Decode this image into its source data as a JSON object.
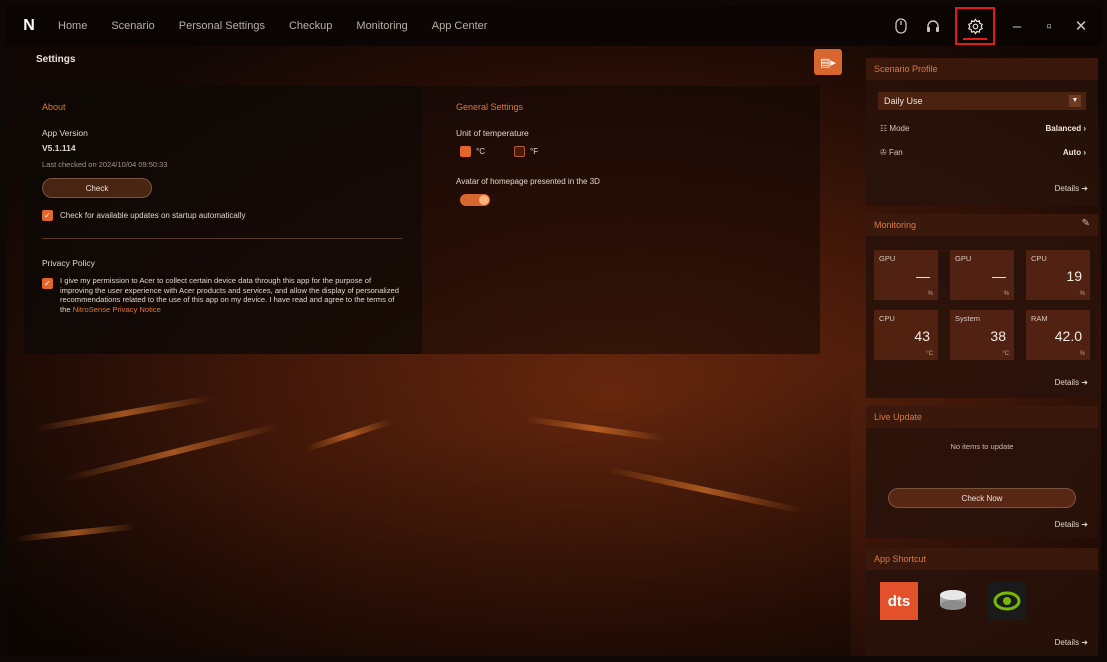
{
  "nav": {
    "items": [
      "Home",
      "Scenario",
      "Personal Settings",
      "Checkup",
      "Monitoring",
      "App Center"
    ]
  },
  "window": {
    "minimize": "–",
    "restore": "▫",
    "close": "✕"
  },
  "settings": {
    "title": "Settings"
  },
  "about": {
    "title": "About",
    "app_version_label": "App Version",
    "app_version": "V5.1.114",
    "last_checked": "Last checked on 2024/10/04 09:50:33",
    "check_label": "Check",
    "auto_update_label": "Check for available updates on startup automatically",
    "privacy_title": "Privacy Policy",
    "privacy_text": "I give my permission to Acer to collect certain device data through this app for the purpose of improving the user experience with Acer products and services, and allow the display of personalized recommendations related to the use of this app on my device. I have read and agree to the terms of the",
    "privacy_link": "NitroSense Privacy Notice"
  },
  "general": {
    "title": "General Settings",
    "unit_label": "Unit of temperature",
    "unit_c": "°C",
    "unit_f": "°F",
    "avatar_label": "Avatar of homepage presented in the 3D"
  },
  "scenario": {
    "title": "Scenario Profile",
    "selected": "Daily Use",
    "mode_label": "Mode",
    "mode_value": "Balanced",
    "fan_label": "Fan",
    "fan_value": "Auto",
    "details": "Details"
  },
  "monitoring": {
    "title": "Monitoring",
    "tiles": [
      {
        "label": "GPU",
        "value": "—",
        "unit": "%"
      },
      {
        "label": "GPU",
        "value": "—",
        "unit": "%"
      },
      {
        "label": "CPU",
        "value": "19",
        "unit": "%"
      },
      {
        "label": "CPU",
        "value": "43",
        "unit": "°C"
      },
      {
        "label": "System",
        "value": "38",
        "unit": "°C"
      },
      {
        "label": "RAM",
        "value": "42.0",
        "unit": "%"
      }
    ],
    "details": "Details"
  },
  "live_update": {
    "title": "Live Update",
    "status": "No items to update",
    "check_now": "Check Now",
    "details": "Details"
  },
  "app_shortcut": {
    "title": "App Shortcut",
    "dts_label": "dts",
    "details": "Details"
  },
  "colors": {
    "accent": "#e2652a",
    "highlight_box": "#e11b1b"
  }
}
